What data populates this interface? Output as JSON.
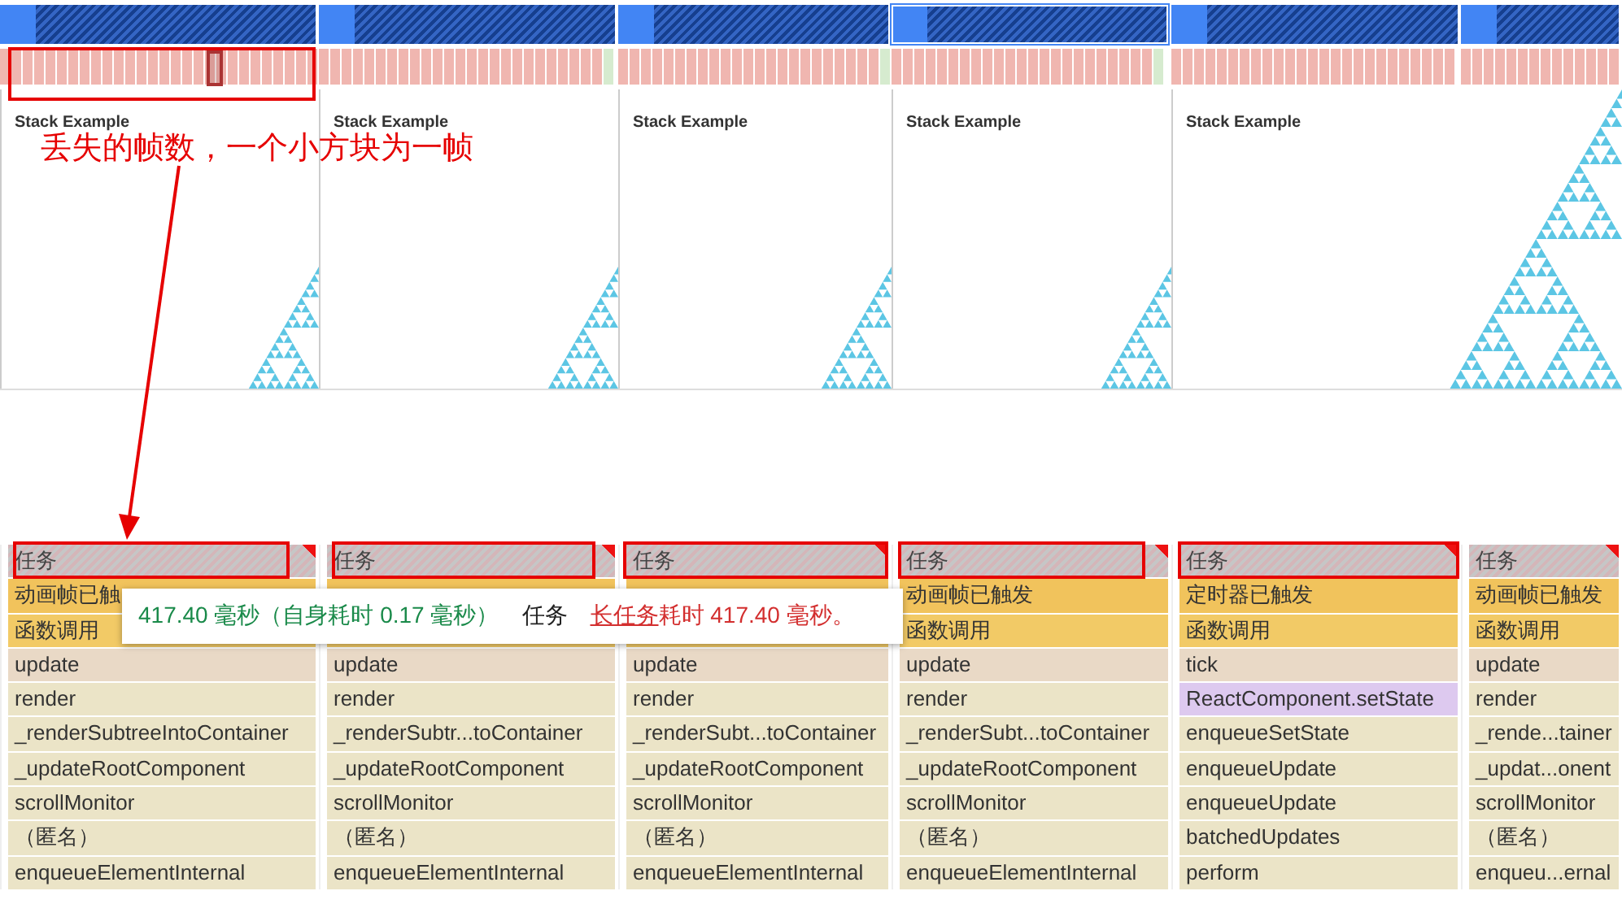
{
  "overview": {
    "cpu_segments": [
      {
        "selected": false
      },
      {
        "selected": false
      },
      {
        "selected": false
      },
      {
        "selected": true
      },
      {
        "selected": false
      },
      {
        "selected": false
      }
    ]
  },
  "screenshots": [
    {
      "title": "Stack Example",
      "kind": "small"
    },
    {
      "title": "Stack Example",
      "kind": "small"
    },
    {
      "title": "Stack Example",
      "kind": "small"
    },
    {
      "title": "Stack Example",
      "kind": "small"
    },
    {
      "title": "Stack Example",
      "kind": "large"
    }
  ],
  "flame_columns": [
    {
      "task": "任务",
      "long_task": true,
      "rows": [
        {
          "kind": "event",
          "text": "动画帧已触"
        },
        {
          "kind": "call",
          "text": "函数调用"
        },
        {
          "kind": "script",
          "text": "update"
        },
        {
          "kind": "function",
          "text": "render"
        },
        {
          "kind": "function",
          "text": "_renderSubtreeIntoContainer"
        },
        {
          "kind": "function",
          "text": "_updateRootComponent"
        },
        {
          "kind": "function",
          "text": "scrollMonitor"
        },
        {
          "kind": "function",
          "text": "（匿名）"
        },
        {
          "kind": "function",
          "text": "enqueueElementInternal"
        }
      ]
    },
    {
      "task": "任务",
      "long_task": true,
      "rows": [
        {
          "kind": "event"
        },
        {
          "kind": "call"
        },
        {
          "kind": "script",
          "text": "update"
        },
        {
          "kind": "function",
          "text": "render"
        },
        {
          "kind": "function",
          "text": "_renderSubtr...toContainer"
        },
        {
          "kind": "function",
          "text": "_updateRootComponent"
        },
        {
          "kind": "function",
          "text": "scrollMonitor"
        },
        {
          "kind": "function",
          "text": "（匿名）"
        },
        {
          "kind": "function",
          "text": "enqueueElementInternal"
        }
      ]
    },
    {
      "task": "任务",
      "long_task": true,
      "rows": [
        {
          "kind": "event"
        },
        {
          "kind": "call"
        },
        {
          "kind": "script",
          "text": "update"
        },
        {
          "kind": "function",
          "text": "render"
        },
        {
          "kind": "function",
          "text": "_renderSubt...toContainer"
        },
        {
          "kind": "function",
          "text": "_updateRootComponent"
        },
        {
          "kind": "function",
          "text": "scrollMonitor"
        },
        {
          "kind": "function",
          "text": "（匿名）"
        },
        {
          "kind": "function",
          "text": "enqueueElementInternal"
        }
      ]
    },
    {
      "task": "任务",
      "long_task": true,
      "rows": [
        {
          "kind": "event",
          "text": "动画帧已触发"
        },
        {
          "kind": "call",
          "text": "函数调用"
        },
        {
          "kind": "script",
          "text": "update"
        },
        {
          "kind": "function",
          "text": "render"
        },
        {
          "kind": "function",
          "text": "_renderSubt...toContainer"
        },
        {
          "kind": "function",
          "text": "_updateRootComponent"
        },
        {
          "kind": "function",
          "text": "scrollMonitor"
        },
        {
          "kind": "function",
          "text": "（匿名）"
        },
        {
          "kind": "function",
          "text": "enqueueElementInternal"
        }
      ]
    },
    {
      "task": "任务",
      "long_task": true,
      "rows": [
        {
          "kind": "event",
          "text": "定时器已触发"
        },
        {
          "kind": "call",
          "text": "函数调用"
        },
        {
          "kind": "script",
          "text": "tick"
        },
        {
          "kind": "method",
          "text": "ReactComponent.setState"
        },
        {
          "kind": "function",
          "text": "enqueueSetState"
        },
        {
          "kind": "function",
          "text": "enqueueUpdate"
        },
        {
          "kind": "function",
          "text": "enqueueUpdate"
        },
        {
          "kind": "function",
          "text": "batchedUpdates"
        },
        {
          "kind": "function",
          "text": "perform"
        }
      ]
    },
    {
      "task": "任务",
      "long_task": true,
      "rows": [
        {
          "kind": "event",
          "text": "动画帧已触发"
        },
        {
          "kind": "call",
          "text": "函数调用"
        },
        {
          "kind": "script",
          "text": "update"
        },
        {
          "kind": "function",
          "text": "render"
        },
        {
          "kind": "function",
          "text": "_rende...tainer"
        },
        {
          "kind": "function",
          "text": "_updat...onent"
        },
        {
          "kind": "function",
          "text": "scrollMonitor"
        },
        {
          "kind": "function",
          "text": "（匿名）"
        },
        {
          "kind": "function",
          "text": "enqueu...ernal"
        }
      ]
    }
  ],
  "tooltip": {
    "duration": "417.40 毫秒（自身耗时 0.17 毫秒）",
    "title": "任务",
    "warning_link": "长任务",
    "warning_text": "耗时 417.40 毫秒。"
  },
  "annotations": {
    "note": "丢失的帧数，一个小方块为一帧"
  }
}
